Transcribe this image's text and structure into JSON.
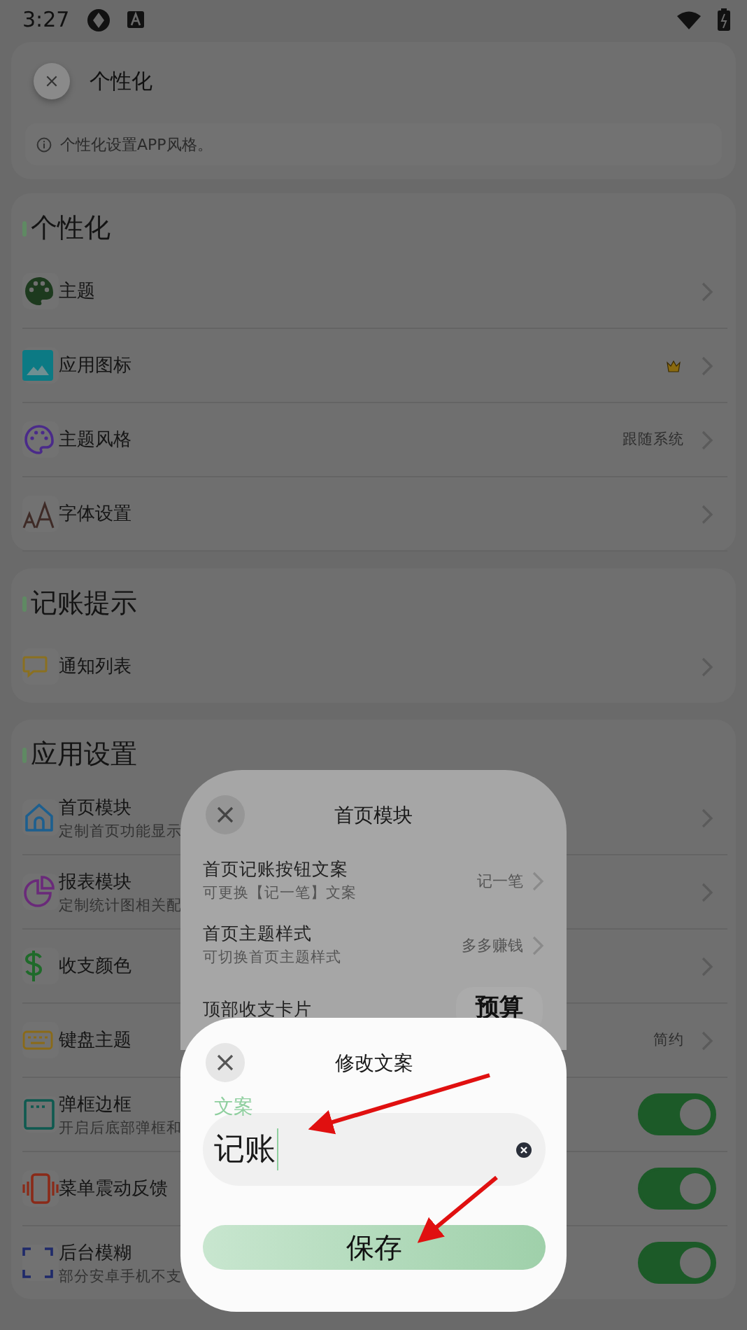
{
  "status_bar": {
    "time": "3:27"
  },
  "header": {
    "title": "个性化",
    "info": "个性化设置APP风格。"
  },
  "sections": [
    {
      "title": "个性化",
      "items": [
        {
          "kind": "link",
          "label": "主题"
        },
        {
          "kind": "link",
          "label": "应用图标"
        },
        {
          "kind": "link",
          "label": "主题风格",
          "value": "跟随系统"
        },
        {
          "kind": "link",
          "label": "字体设置"
        }
      ]
    },
    {
      "title": "记账提示",
      "items": [
        {
          "kind": "link",
          "label": "通知列表"
        }
      ]
    },
    {
      "title": "应用设置",
      "items": [
        {
          "kind": "link",
          "label": "首页模块",
          "subtitle": "定制首页功能显示"
        },
        {
          "kind": "link",
          "label": "报表模块",
          "subtitle": "定制统计图相关配"
        },
        {
          "kind": "link",
          "label": "收支颜色"
        },
        {
          "kind": "link",
          "label": "键盘主题",
          "value": "简约"
        },
        {
          "kind": "toggle",
          "label": "弹框边框",
          "subtitle": "开启后底部弹框和",
          "on": true
        },
        {
          "kind": "toggle",
          "label": "菜单震动反馈",
          "on": true
        },
        {
          "kind": "toggle",
          "label": "后台模糊",
          "subtitle": "部分安卓手机不支",
          "on": true
        }
      ]
    }
  ],
  "module_dialog": {
    "title": "首页模块",
    "items": [
      {
        "kind": "link",
        "label": "首页记账按钮文案",
        "subtitle": "可更换【记一笔】文案",
        "value": "记一笔"
      },
      {
        "kind": "link",
        "label": "首页主题样式",
        "subtitle": "可切换首页主题样式",
        "value": "多多赚钱"
      },
      {
        "kind": "choice",
        "label": "顶部收支卡片",
        "value": "预算"
      }
    ]
  },
  "edit_dialog": {
    "title": "修改文案",
    "field": {
      "label": "文案",
      "value": "记账"
    },
    "save_button": "保存"
  }
}
